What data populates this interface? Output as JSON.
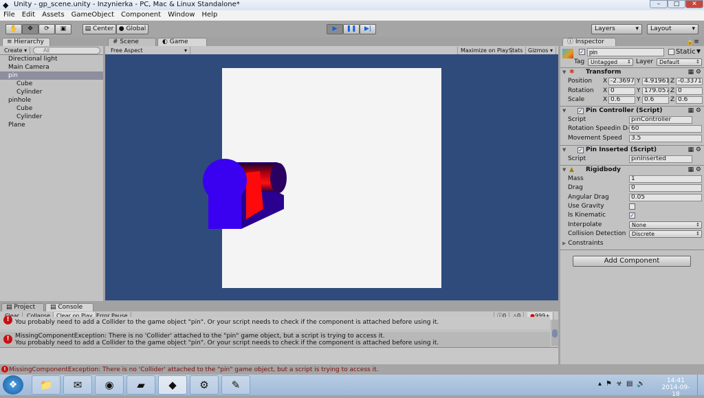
{
  "window": {
    "title": "Unity - gp_scene.unity - Inzynierka - PC, Mac & Linux Standalone*",
    "minimize": "–",
    "maximize": "□",
    "close": "✕"
  },
  "menu": [
    "File",
    "Edit",
    "Assets",
    "GameObject",
    "Component",
    "Window",
    "Help"
  ],
  "toolbar": {
    "tools": [
      "hand-icon",
      "move-icon",
      "rotate-icon",
      "scale-icon"
    ],
    "pivot": "Center",
    "space": "Global",
    "layers": "Layers",
    "layout": "Layout"
  },
  "hierarchy": {
    "tab": "Hierarchy",
    "create": "Create",
    "search_placeholder": "All",
    "items": [
      {
        "label": "Directional light",
        "indent": 0
      },
      {
        "label": "Main Camera",
        "indent": 0
      },
      {
        "label": "pin",
        "indent": 0,
        "selected": true
      },
      {
        "label": "Cube",
        "indent": 1
      },
      {
        "label": "Cylinder",
        "indent": 1
      },
      {
        "label": "pinhole",
        "indent": 0
      },
      {
        "label": "Cube",
        "indent": 1
      },
      {
        "label": "Cylinder",
        "indent": 1
      },
      {
        "label": "Plane",
        "indent": 0
      }
    ]
  },
  "game": {
    "tabs": [
      "Scene",
      "Game"
    ],
    "aspect": "Free Aspect",
    "maximize": "Maximize on Play",
    "stats": "Stats",
    "gizmos": "Gizmos"
  },
  "inspector": {
    "tab": "Inspector",
    "name": "pin",
    "static": "Static",
    "tag_label": "Tag",
    "tag": "Untagged",
    "layer_label": "Layer",
    "layer": "Default",
    "transform": {
      "title": "Transform",
      "rows": [
        {
          "label": "Position",
          "x": "-2.3697",
          "y": "4.91961",
          "z": "-0.3371"
        },
        {
          "label": "Rotation",
          "x": "0",
          "y": "179.057",
          "z": "0"
        },
        {
          "label": "Scale",
          "x": "0.6",
          "y": "0.6",
          "z": "0.6"
        }
      ]
    },
    "pin_controller": {
      "title": "Pin Controller (Script)",
      "script_label": "Script",
      "script": "pinController",
      "rot_label": "Rotation Speedin De",
      "rot": "60",
      "move_label": "Movement Speed",
      "move": "3.5"
    },
    "pin_inserted": {
      "title": "Pin Inserted (Script)",
      "script_label": "Script",
      "script": "pinInserted"
    },
    "rigidbody": {
      "title": "Rigidbody",
      "mass_label": "Mass",
      "mass": "1",
      "drag_label": "Drag",
      "drag": "0",
      "adrag_label": "Angular Drag",
      "adrag": "0.05",
      "gravity_label": "Use Gravity",
      "kinematic_label": "Is Kinematic",
      "interp_label": "Interpolate",
      "interp": "None",
      "coll_label": "Collision Detection",
      "coll": "Discrete",
      "constraints": "Constraints"
    },
    "add_component": "Add Component"
  },
  "console": {
    "tabs": [
      "Project",
      "Console"
    ],
    "buttons": [
      "Clear",
      "Collapse",
      "Clear on Play",
      "Error Pause"
    ],
    "info_count": "0",
    "warn_count": "0",
    "error_count": "999+",
    "messages": [
      {
        "line1": "MissingComponentException: There is no 'Collider' attached to the \"pin\" game object, but a script is trying to access it.",
        "line2": "You probably need to add a Collider to the game object \"pin\". Or your script needs to check if the component is attached before using it."
      },
      {
        "line1": "MissingComponentException: There is no 'Collider' attached to the \"pin\" game object, but a script is trying to access it.",
        "line2": "You probably need to add a Collider to the game object \"pin\". Or your script needs to check if the component is attached before using it."
      }
    ]
  },
  "status": "MissingComponentException: There is no 'Collider' attached to the \"pin\" game object, but a script is trying to access it.",
  "taskbar": {
    "time": "14:41",
    "date": "2014-09-18",
    "apps": [
      "explorer-icon",
      "thunderbird-icon",
      "chrome-icon",
      "app-icon",
      "unity-icon",
      "monodevelop-icon",
      "editor-icon"
    ]
  }
}
